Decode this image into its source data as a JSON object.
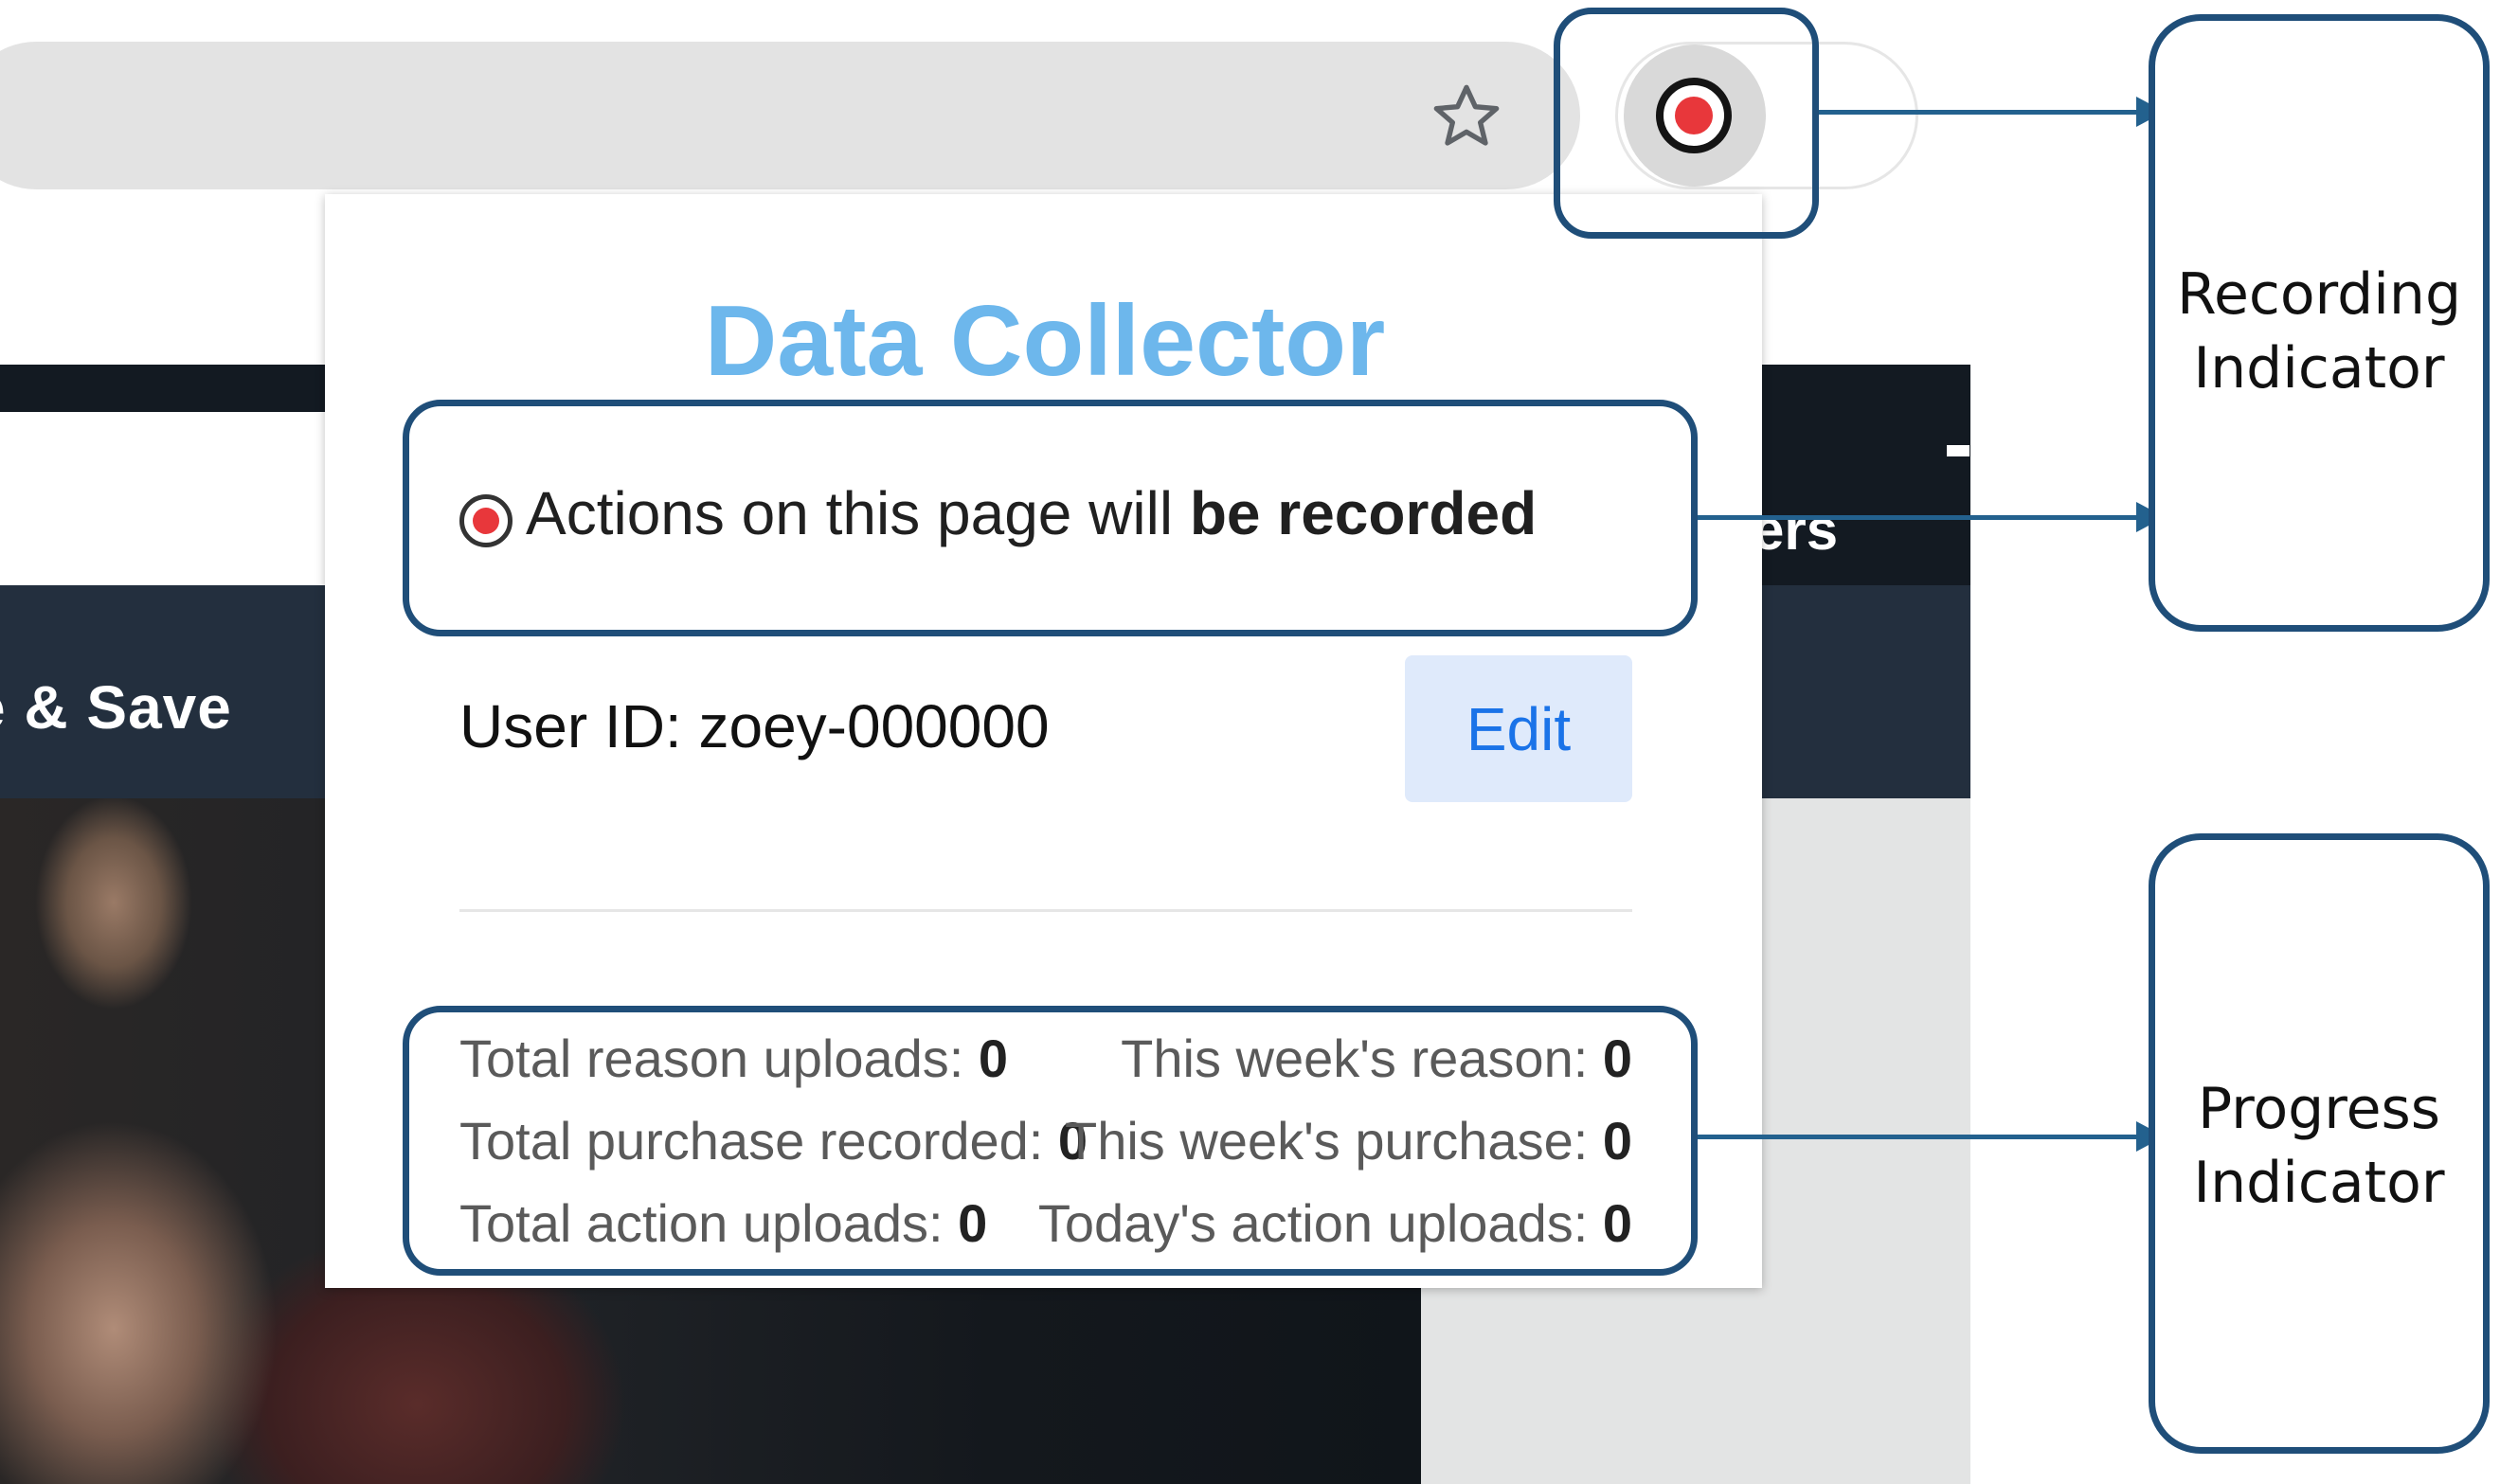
{
  "popup": {
    "title": "Data Collector",
    "status_prefix": "Actions on this page will ",
    "status_bold": "be recorded",
    "user_id_text": "User ID: zoey-000000",
    "edit_label": "Edit",
    "stats": [
      {
        "label": "Total reason uploads: ",
        "value": "0"
      },
      {
        "label": "This week's reason: ",
        "value": "0"
      },
      {
        "label": "Total purchase recorded: ",
        "value": "0"
      },
      {
        "label": "This week's purchase: ",
        "value": "0"
      },
      {
        "label": "Total action uploads: ",
        "value": "0"
      },
      {
        "label": "Today's action uploads: ",
        "value": "0"
      }
    ]
  },
  "background_page": {
    "nav_partial_text": "e & Save",
    "partial_text_right": "ers"
  },
  "annotations": {
    "recording_label_line1": "Recording",
    "recording_label_line2": "Indicator",
    "progress_label_line1": "Progress",
    "progress_label_line2": "Indicator"
  },
  "icons": {
    "bookmark": "star-outline-icon",
    "extension": "record-icon",
    "status": "record-icon"
  },
  "colors": {
    "title": "#6db7ec",
    "record_dot": "#e8373b",
    "annotation": "#1f4e79",
    "edit_text": "#1a73e8",
    "edit_bg": "#dfeafb"
  }
}
